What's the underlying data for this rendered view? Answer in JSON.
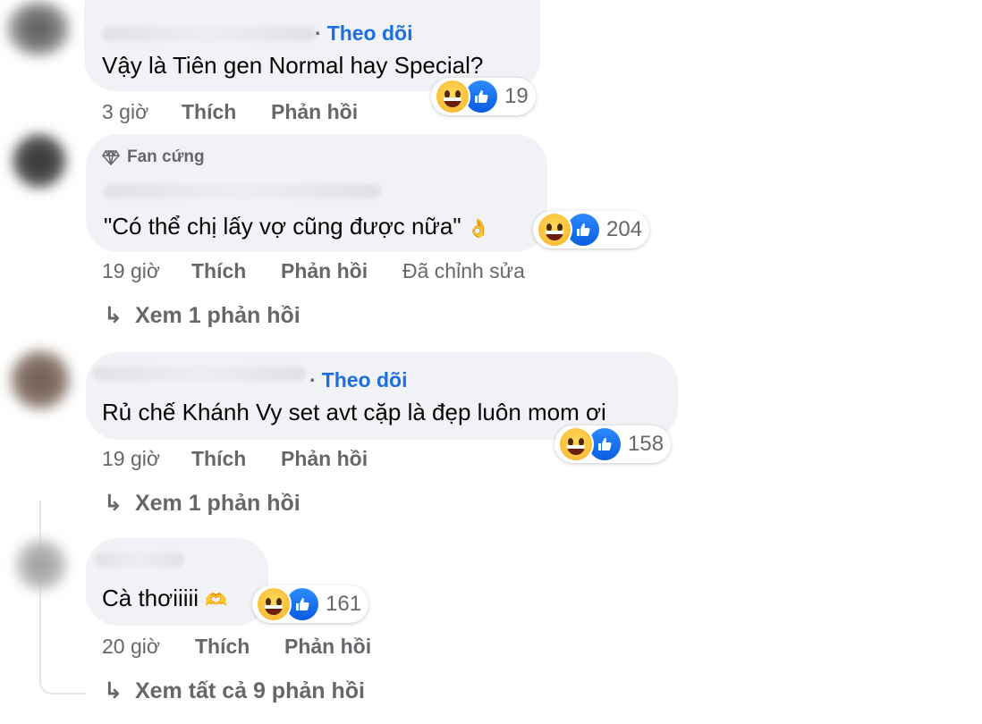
{
  "comments": [
    {
      "follow": "Theo dõi",
      "text": "Vậy là Tiên gen Normal hay Special?",
      "reaction_count": "19",
      "time": "3 giờ",
      "like": "Thích",
      "reply": "Phản hồi"
    },
    {
      "badge": "Fan cứng",
      "text": "\"Có thể chị lấy vợ cũng được nữa\"",
      "reaction_count": "204",
      "time": "19 giờ",
      "like": "Thích",
      "reply": "Phản hồi",
      "edited": "Đã chỉnh sửa",
      "view_replies": "Xem 1 phản hồi"
    },
    {
      "follow": "Theo dõi",
      "text": "Rủ chế Khánh Vy set avt cặp là đẹp luôn mom ơi",
      "reaction_count": "158",
      "time": "19 giờ",
      "like": "Thích",
      "reply": "Phản hồi",
      "view_replies": "Xem 1 phản hồi"
    },
    {
      "text": "Cà thơiiiii",
      "reaction_count": "161",
      "time": "20 giờ",
      "like": "Thích",
      "reply": "Phản hồi"
    }
  ],
  "view_all": "Xem tất cả 9 phản hồi",
  "icons": {
    "reaction_haha": "haha-icon",
    "reaction_like": "like-icon",
    "badge": "diamond-icon",
    "reply_arrow": "reply-arrow-icon"
  },
  "colors": {
    "bubble": "#f0f2f5",
    "link": "#1d6fe0",
    "muted": "#65676b"
  }
}
